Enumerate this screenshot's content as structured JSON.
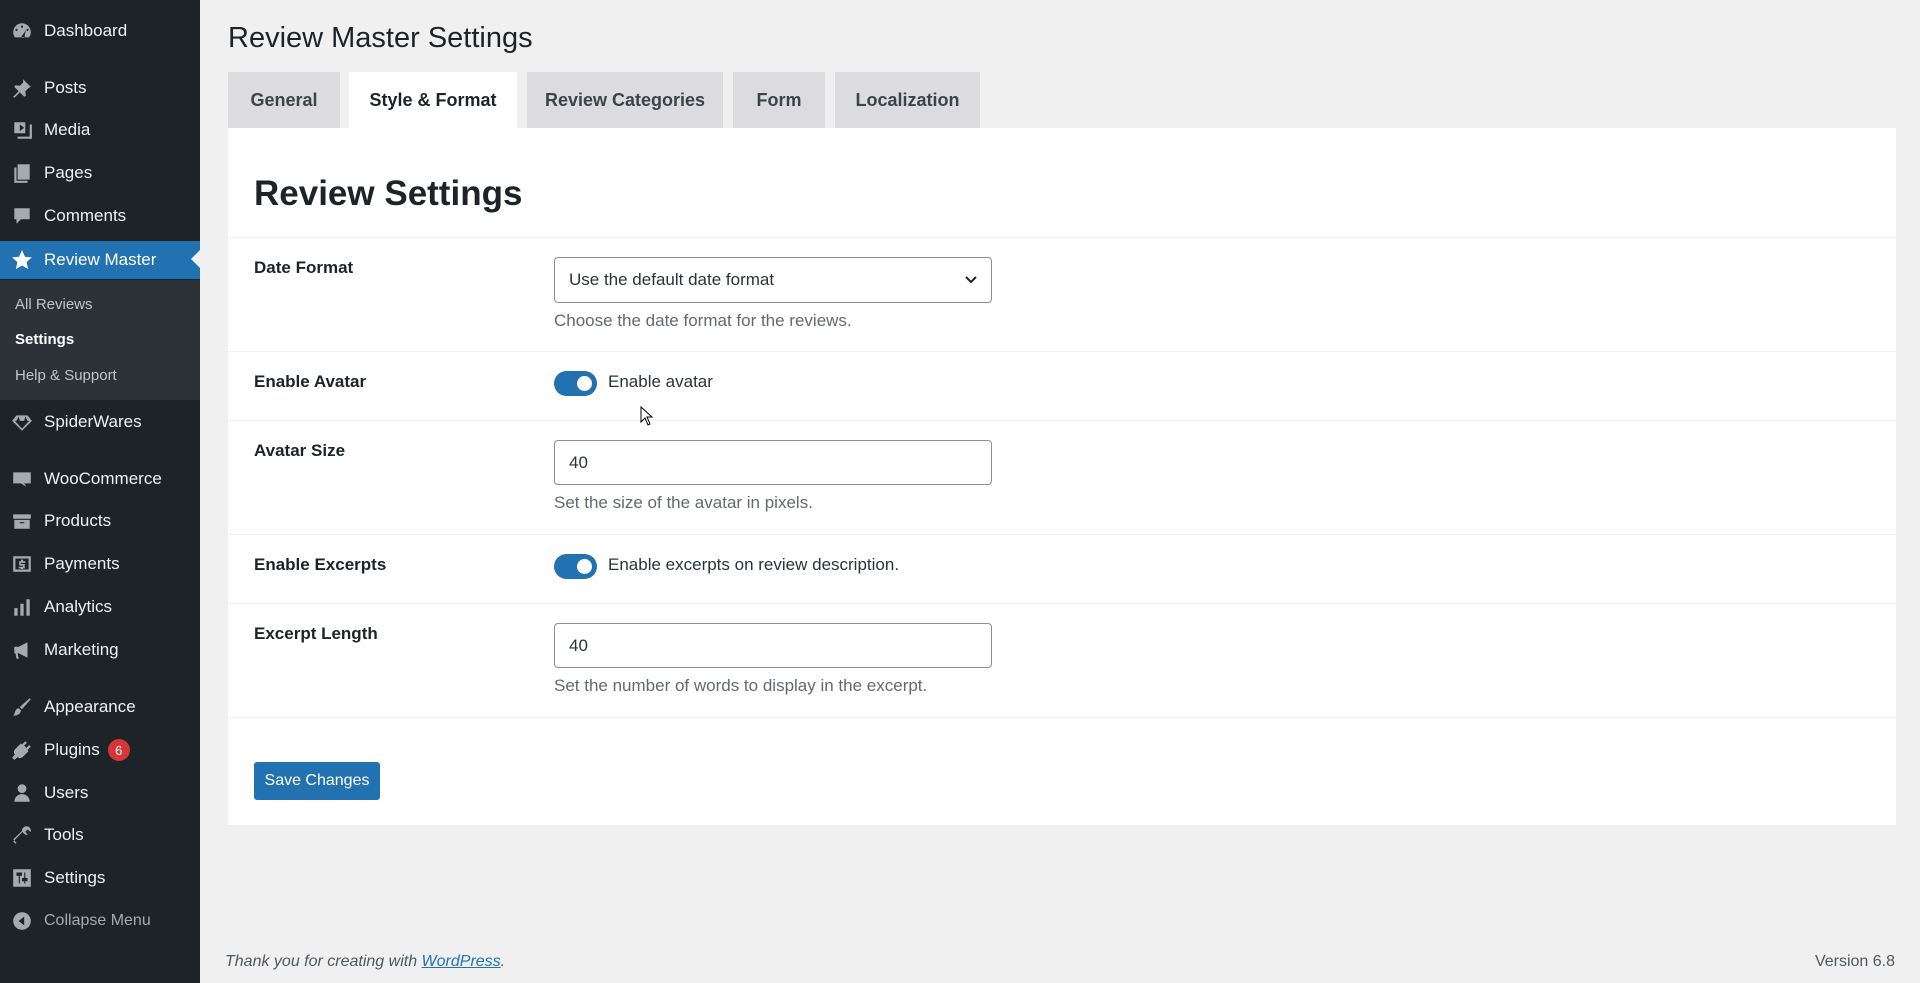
{
  "sidebar": {
    "items": [
      {
        "label": "Dashboard",
        "icon": "dashboard-icon"
      },
      {
        "label": "Posts",
        "icon": "pin-icon"
      },
      {
        "label": "Media",
        "icon": "media-icon"
      },
      {
        "label": "Pages",
        "icon": "pages-icon"
      },
      {
        "label": "Comments",
        "icon": "comment-icon"
      },
      {
        "label": "Review Master",
        "icon": "star-icon"
      },
      {
        "label": "SpiderWares",
        "icon": "diamond-icon"
      },
      {
        "label": "WooCommerce",
        "icon": "woo-icon"
      },
      {
        "label": "Products",
        "icon": "archive-icon"
      },
      {
        "label": "Payments",
        "icon": "dollar-icon"
      },
      {
        "label": "Analytics",
        "icon": "bar-chart-icon"
      },
      {
        "label": "Marketing",
        "icon": "megaphone-icon"
      },
      {
        "label": "Appearance",
        "icon": "brush-icon"
      },
      {
        "label": "Plugins",
        "icon": "plugin-icon",
        "badge": "6"
      },
      {
        "label": "Users",
        "icon": "user-icon"
      },
      {
        "label": "Tools",
        "icon": "wrench-icon"
      },
      {
        "label": "Settings",
        "icon": "sliders-icon"
      }
    ],
    "submenu": [
      "All Reviews",
      "Settings",
      "Help & Support"
    ],
    "collapse_label": "Collapse Menu"
  },
  "page_title": "Review Master Settings",
  "tabs": [
    "General",
    "Style & Format",
    "Review Categories",
    "Form",
    "Localization"
  ],
  "active_tab": "Style & Format",
  "section_title": "Review Settings",
  "fields": {
    "date_format": {
      "label": "Date Format",
      "value": "Use the default date format",
      "description": "Choose the date format for the reviews."
    },
    "enable_avatar": {
      "label": "Enable Avatar",
      "toggle_label": "Enable avatar",
      "checked": true
    },
    "avatar_size": {
      "label": "Avatar Size",
      "value": "40",
      "description": "Set the size of the avatar in pixels."
    },
    "enable_excerpts": {
      "label": "Enable Excerpts",
      "toggle_label": "Enable excerpts on review description.",
      "checked": true
    },
    "excerpt_length": {
      "label": "Excerpt Length",
      "value": "40",
      "description": "Set the number of words to display in the excerpt."
    }
  },
  "save_label": "Save Changes",
  "footer": {
    "thanks_prefix": "Thank you for creating with ",
    "wp_link": "WordPress",
    "thanks_suffix": ".",
    "version": "Version 6.8"
  },
  "colors": {
    "sidebar_bg": "#1d2327",
    "accent": "#2271b1",
    "badge": "#d63638"
  }
}
